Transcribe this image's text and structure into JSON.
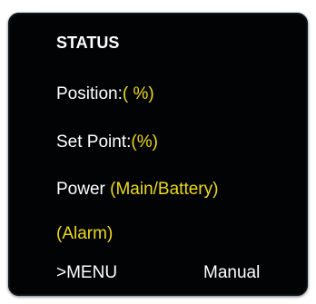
{
  "title": "STATUS",
  "position": {
    "label": "Position:",
    "value": "( %)"
  },
  "set_point": {
    "label": "Set Point:",
    "value": "(%)"
  },
  "power": {
    "label": "Power",
    "value": "(Main/Battery)"
  },
  "alarm": "(Alarm)",
  "footer": {
    "menu": ">MENU",
    "mode": "Manual"
  },
  "colors": {
    "background": "#020305",
    "text": "#ffffff",
    "value": "#ecd91e"
  }
}
